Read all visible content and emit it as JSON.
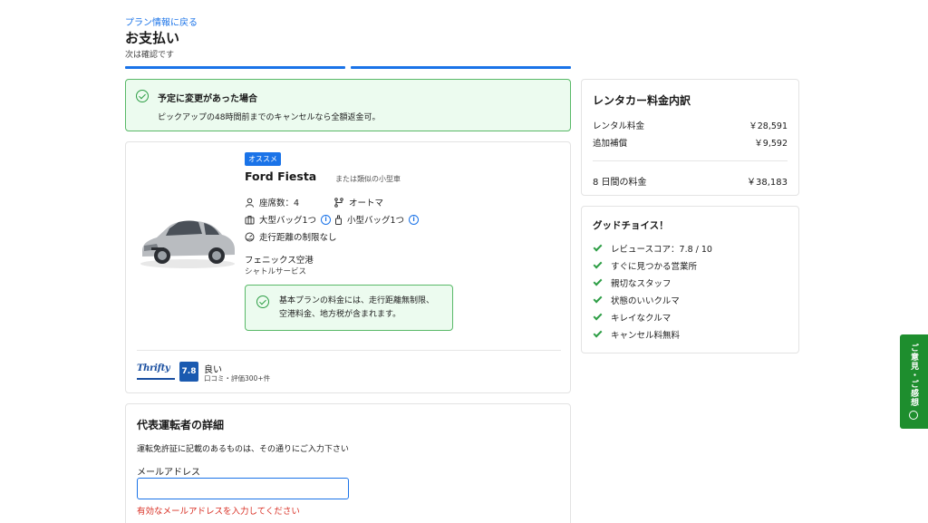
{
  "header": {
    "back_link": "プラン情報に戻る",
    "title": "お支払い",
    "subtitle": "次は確認です"
  },
  "notice": {
    "title": "予定に変更があった場合",
    "body": "ピックアップの48時間前までのキャンセルなら全額返金可。"
  },
  "car": {
    "badge": "オススメ",
    "name": "Ford Fiesta",
    "similar": "または類似の小型車",
    "seats": "座席数：4",
    "transmission": "オートマ",
    "large_bags": "大型バッグ1つ",
    "small_bags": "小型バッグ1つ",
    "mileage": "走行距離の制限なし",
    "location_name": "フェニックス空港",
    "location_sub": "シャトルサービス",
    "inner_notice_line1": "基本プランの料金には、走行距離無制限、",
    "inner_notice_line2": "空港料金、地方税が含まれます。",
    "supplier_logo": "Thrifty",
    "score": "7.8",
    "rating_word": "良い",
    "rating_count": "口コミ・評価300+件"
  },
  "driver": {
    "title": "代表運転者の詳細",
    "hint": "運転免許証に記載のあるものは、その通りにご入力下さい",
    "email_label": "メールアドレス",
    "email_value": "",
    "email_error": "有効なメールアドレスを入力してください"
  },
  "price": {
    "title": "レンタカー料金内訳",
    "rows": [
      {
        "label": "レンタル料金",
        "value": "￥28,591"
      },
      {
        "label": "追加補償",
        "value": "￥9,592"
      }
    ],
    "total_label": "8 日間の料金",
    "total_value": "￥38,183"
  },
  "good_choice": {
    "title": "グッドチョイス！",
    "items": [
      "レビュースコア：7.8 / 10",
      "すぐに見つかる営業所",
      "親切なスタッフ",
      "状態のいいクルマ",
      "キレイなクルマ",
      "キャンセル料無料"
    ]
  },
  "feedback": {
    "label": "ご意見・ご感想"
  },
  "colors": {
    "accent": "#1a73e8",
    "success": "#2e9e46",
    "success_bg": "#ecfbef",
    "error": "#d93025",
    "feedback_bg": "#1e8e2e"
  }
}
